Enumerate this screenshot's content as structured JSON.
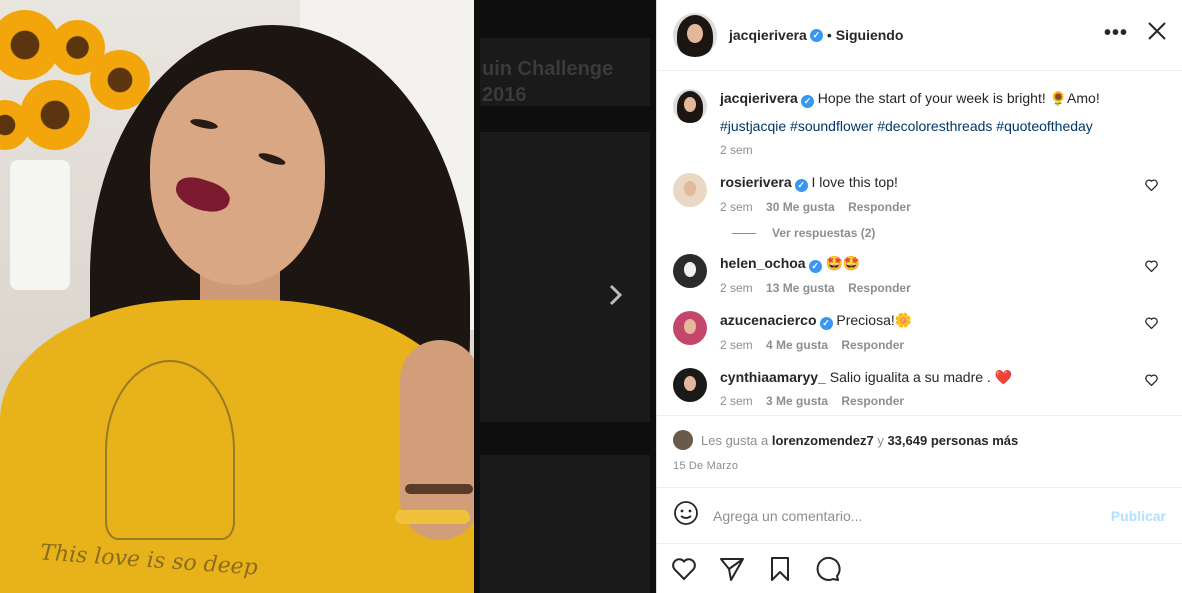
{
  "photo": {
    "shirt_text": "This love is so deep"
  },
  "backdrop": {
    "ghost_title_1": "uin Challenge",
    "ghost_title_2": "2016"
  },
  "header": {
    "username": "jacqierivera",
    "verified_glyph": "✓",
    "separator": "•",
    "follow_status": "Siguiendo",
    "more_glyph": "•••",
    "close_glyph": "✕"
  },
  "caption": {
    "username": "jacqierivera",
    "text": "Hope the start of your week is bright! 🌻Amo!",
    "hashtags": "#justjacqie #soundflower #decoloresthreads #quoteoftheday",
    "time": "2 sem"
  },
  "comments": [
    {
      "username": "rosierivera",
      "text": "I love this top!",
      "time": "2 sem",
      "likes": "30 Me gusta",
      "reply": "Responder",
      "avatar_color": "#e8d8c4"
    },
    {
      "username": "helen_ochoa",
      "text": "🤩🤩",
      "time": "2 sem",
      "likes": "13 Me gusta",
      "reply": "Responder",
      "avatar_color": "#2b2b2b"
    },
    {
      "username": "azucenacierco",
      "text": "Preciosa!🌼",
      "time": "2 sem",
      "likes": "4 Me gusta",
      "reply": "Responder",
      "avatar_color": "#c4476b"
    },
    {
      "username": "cynthiaamaryy_",
      "text": "Salio igualita a su madre . ❤️",
      "time": "2 sem",
      "likes": "3 Me gusta",
      "reply": "Responder",
      "avatar_color": "#1a1a1a"
    }
  ],
  "view_replies": "Ver respuestas (2)",
  "liked_by": {
    "prefix": "Les gusta a",
    "user": "lorenzomendez7",
    "connector": "y",
    "count": "33,649 personas más"
  },
  "date": "15 De Marzo",
  "add_comment": {
    "placeholder": "Agrega un comentario...",
    "publish": "Publicar"
  },
  "icons": {
    "heart": "heart-icon",
    "share": "paper-plane-icon",
    "save": "bookmark-icon",
    "comment": "speech-bubble-icon",
    "emoji": "smiley-icon"
  },
  "colors": {
    "verified": "#3897f0",
    "hashtag": "#00376b",
    "publish_disabled": "#b2dffc",
    "muted": "#8e8e8e"
  }
}
